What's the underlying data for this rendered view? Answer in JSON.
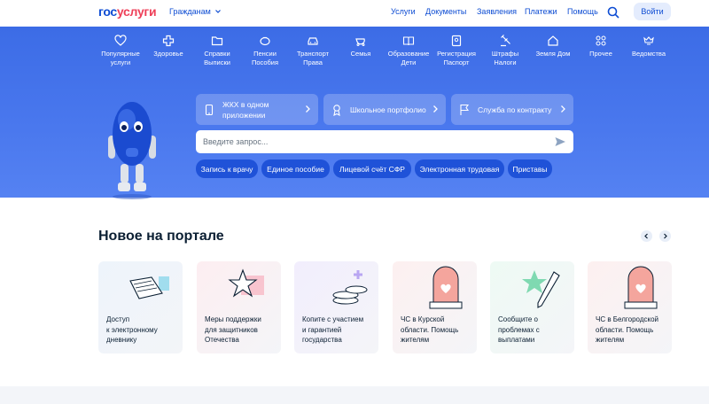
{
  "header": {
    "logo_part1": "гос",
    "logo_part2": "услуги",
    "role": "Гражданам",
    "nav": [
      "Услуги",
      "Документы",
      "Заявления",
      "Платежи",
      "Помощь"
    ],
    "login": "Войти"
  },
  "categories": [
    {
      "label": "Популярные\nуслуги",
      "icon": "heart-icon"
    },
    {
      "label": "Здоровье",
      "icon": "medical-cross-icon"
    },
    {
      "label": "Справки\nВыписки",
      "icon": "folder-icon"
    },
    {
      "label": "Пенсии\nПособия",
      "icon": "piggy-bank-icon"
    },
    {
      "label": "Транспорт\nПрава",
      "icon": "car-icon"
    },
    {
      "label": "Семья",
      "icon": "stroller-icon"
    },
    {
      "label": "Образование\nДети",
      "icon": "book-icon"
    },
    {
      "label": "Регистрация\nПаспорт",
      "icon": "passport-icon"
    },
    {
      "label": "Штрафы\nНалоги",
      "icon": "gavel-icon"
    },
    {
      "label": "Земля Дом",
      "icon": "house-icon"
    },
    {
      "label": "Прочее",
      "icon": "grid-icon"
    },
    {
      "label": "Ведомства",
      "icon": "emblem-icon"
    }
  ],
  "services": [
    {
      "label": "ЖКХ в одном\nприложении",
      "icon": "phone-icon"
    },
    {
      "label": "Школьное портфолио",
      "icon": "award-icon"
    },
    {
      "label": "Служба по контракту",
      "icon": "flag-icon"
    }
  ],
  "search": {
    "placeholder": "Введите запрос..."
  },
  "chips": [
    "Запись к врачу",
    "Единое пособие",
    "Лицевой счёт СФР",
    "Электронная трудовая",
    "Приставы"
  ],
  "news": {
    "title": "Новое на портале",
    "cards": [
      {
        "text": "Доступ\nк электронному\nдневнику",
        "icon": "diary-icon"
      },
      {
        "text": "Меры поддержки\nдля защитников\nОтечества",
        "icon": "star-icon"
      },
      {
        "text": "Копите с участием\nи гарантией\nгосударства",
        "icon": "coins-icon"
      },
      {
        "text": "ЧС в Курской\nобласти. Помощь\nжителям",
        "icon": "siren-icon"
      },
      {
        "text": "Сообщите о\nпроблемах с\nвыплатами",
        "icon": "pen-icon"
      },
      {
        "text": "ЧС в Белгородской\nобласти. Помощь\nжителям",
        "icon": "siren-icon"
      }
    ]
  },
  "colors": {
    "brand_blue": "#0d4cd3",
    "brand_red": "#ee3f58",
    "hero": "#4a78ee",
    "chip": "#1f52d8"
  }
}
